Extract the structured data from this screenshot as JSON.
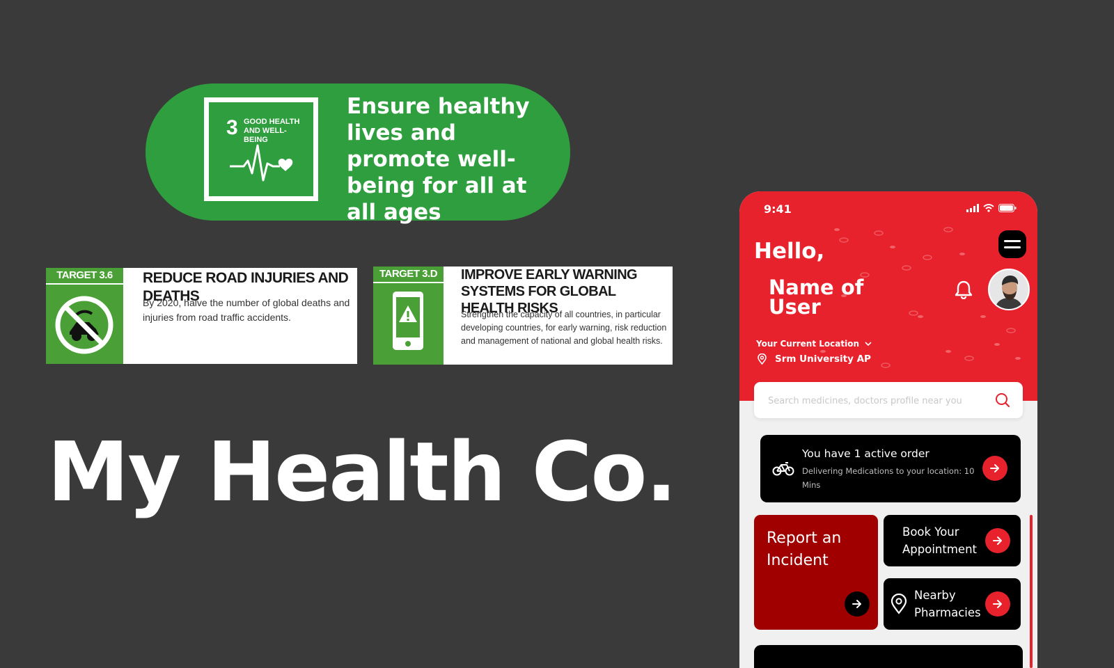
{
  "sdg": {
    "number": "3",
    "goal_label": "GOOD HEALTH AND WELL-BEING",
    "headline": "Ensure healthy lives and promote well-being for all at all ages"
  },
  "targets": [
    {
      "label": "TARGET 3.6",
      "title": "REDUCE ROAD INJURIES AND DEATHS",
      "description": "By 2020, halve the number of global deaths and injuries from road traffic accidents."
    },
    {
      "label": "TARGET 3.D",
      "title": "IMPROVE EARLY WARNING SYSTEMS FOR GLOBAL HEALTH RISKS",
      "description": "Strengthen the capacity of all countries, in particular developing countries, for early warning, risk reduction and management of national and global health risks."
    }
  ],
  "brand": "My Health Co.",
  "phone": {
    "status_time": "9:41",
    "greeting": "Hello,",
    "user_name": "Name of User",
    "location_label": "Your Current Location",
    "location_value": "Srm University AP",
    "search_placeholder": "Search medicines, doctors profile near you",
    "order": {
      "title": "You have 1 active order",
      "subtitle": "Delivering Medications to your location: 10 Mins"
    },
    "incident_label": "Report an Incident",
    "appointment_label": "Book Your Appointment",
    "pharmacies_label": "Nearby Pharmacies"
  },
  "colors": {
    "background": "#3a3a3a",
    "sdg_green": "#2f9e3e",
    "target_green": "#4aa036",
    "accent_red": "#e8222c",
    "incident_red": "#a00000"
  }
}
